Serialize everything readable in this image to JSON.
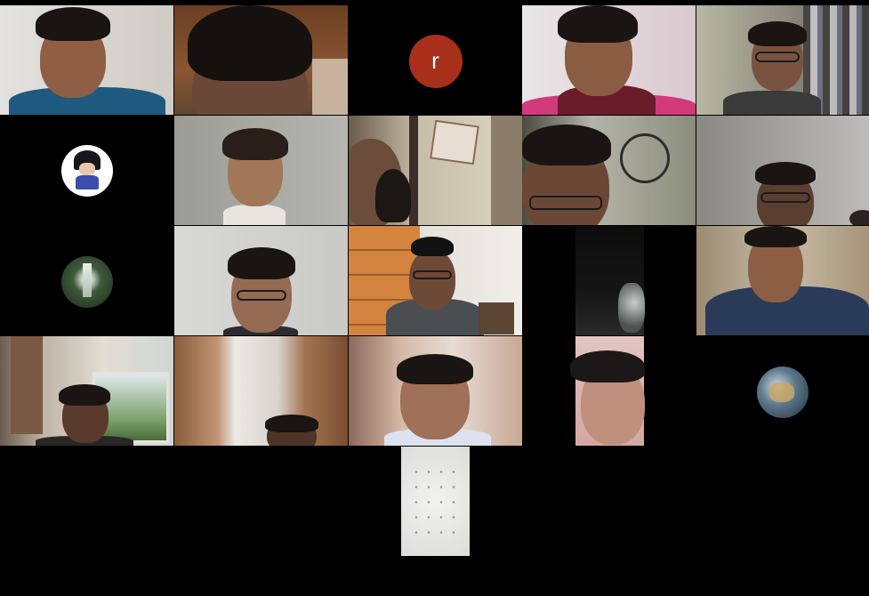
{
  "window": {
    "title": ""
  },
  "participants": [
    {
      "id": "p1",
      "kind": "video"
    },
    {
      "id": "p2",
      "kind": "video"
    },
    {
      "id": "p3",
      "kind": "initial",
      "initial": "r",
      "color": "#a8301a"
    },
    {
      "id": "p4",
      "kind": "video"
    },
    {
      "id": "p5",
      "kind": "video"
    },
    {
      "id": "p6",
      "kind": "avatar",
      "icon": "cartoon-character-avatar-icon"
    },
    {
      "id": "p7",
      "kind": "video"
    },
    {
      "id": "p8",
      "kind": "video"
    },
    {
      "id": "p9",
      "kind": "video"
    },
    {
      "id": "p10",
      "kind": "video"
    },
    {
      "id": "p11",
      "kind": "avatar",
      "icon": "waterfall-avatar-icon"
    },
    {
      "id": "p12",
      "kind": "video"
    },
    {
      "id": "p13",
      "kind": "video"
    },
    {
      "id": "p14",
      "kind": "video-portrait"
    },
    {
      "id": "p15",
      "kind": "video"
    },
    {
      "id": "p16",
      "kind": "video"
    },
    {
      "id": "p17",
      "kind": "video"
    },
    {
      "id": "p18",
      "kind": "video"
    },
    {
      "id": "p19",
      "kind": "video-portrait"
    },
    {
      "id": "p20",
      "kind": "avatar",
      "icon": "fantasy-art-avatar-icon"
    },
    {
      "id": "p21",
      "kind": "video-portrait"
    }
  ],
  "colors": {
    "background": "#000000",
    "initial_avatar": "#a8301a"
  }
}
